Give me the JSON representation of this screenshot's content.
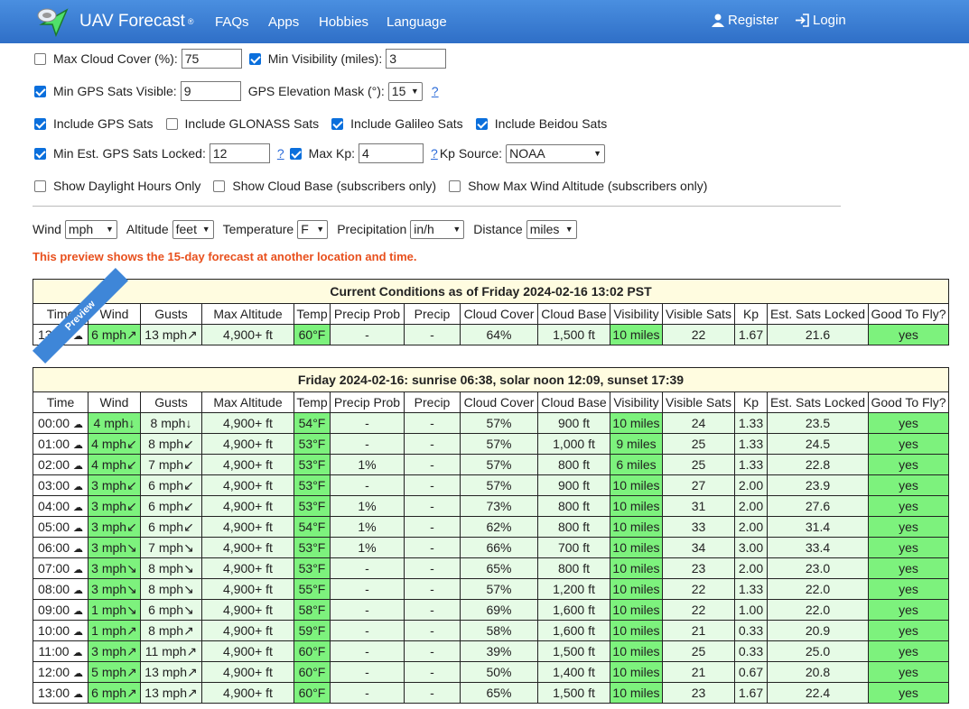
{
  "nav": {
    "brand": "UAV Forecast",
    "brand_mark": "®",
    "links": [
      "FAQs",
      "Apps",
      "Hobbies",
      "Language"
    ],
    "register": "Register",
    "login": "Login"
  },
  "filters": {
    "max_cloud": {
      "label": "Max Cloud Cover (%):",
      "value": "75",
      "checked": false
    },
    "min_vis": {
      "label": "Min Visibility (miles):",
      "value": "3",
      "checked": true
    },
    "min_gps": {
      "label": "Min GPS Sats Visible:",
      "value": "9",
      "checked": true
    },
    "gps_mask": {
      "label": "GPS Elevation Mask (°):",
      "value": "15",
      "help": "?"
    },
    "include_gps": {
      "label": "Include GPS Sats",
      "checked": true
    },
    "include_glonass": {
      "label": "Include GLONASS Sats",
      "checked": false
    },
    "include_galileo": {
      "label": "Include Galileo Sats",
      "checked": true
    },
    "include_beidou": {
      "label": "Include Beidou Sats",
      "checked": true
    },
    "min_locked": {
      "label": "Min Est. GPS Sats Locked:",
      "value": "12",
      "checked": true,
      "help": "?"
    },
    "max_kp": {
      "label": "Max Kp:",
      "value": "4",
      "checked": true,
      "help": "?"
    },
    "kp_source": {
      "label": "Kp Source:",
      "value": "NOAA"
    },
    "daylight": {
      "label": "Show Daylight Hours Only",
      "checked": false
    },
    "cloud_base": {
      "label": "Show Cloud Base (subscribers only)",
      "checked": false
    },
    "max_wind_alt": {
      "label": "Show Max Wind Altitude (subscribers only)",
      "checked": false
    }
  },
  "units": {
    "wind": {
      "label": "Wind",
      "value": "mph"
    },
    "altitude": {
      "label": "Altitude",
      "value": "feet"
    },
    "temperature": {
      "label": "Temperature",
      "value": "F"
    },
    "precipitation": {
      "label": "Precipitation",
      "value": "in/h"
    },
    "distance": {
      "label": "Distance",
      "value": "miles"
    }
  },
  "notice": "This preview shows the 15-day forecast at another location and time.",
  "ribbon": "Preview",
  "columns": [
    "Time",
    "Wind",
    "Gusts",
    "Max Altitude",
    "Temp",
    "Precip Prob",
    "Precip",
    "Cloud Cover",
    "Cloud Base",
    "Visibility",
    "Visible Sats",
    "Kp",
    "Est. Sats Locked",
    "Good To Fly?"
  ],
  "current": {
    "title": "Current Conditions as of Friday 2024-02-16 13:02 PST",
    "row": [
      "13:02",
      "6 mph↗",
      "13 mph↗",
      "4,900+ ft",
      "60°F",
      "-",
      "-",
      "64%",
      "1,500 ft",
      "10 miles",
      "22",
      "1.67",
      "21.6",
      "yes"
    ]
  },
  "daily": {
    "title": "Friday 2024-02-16: sunrise 06:38, solar noon 12:09, sunset 17:39",
    "rows": [
      [
        "00:00",
        "4 mph↓",
        "8 mph↓",
        "4,900+ ft",
        "54°F",
        "-",
        "-",
        "57%",
        "900 ft",
        "10 miles",
        "24",
        "1.33",
        "23.5",
        "yes"
      ],
      [
        "01:00",
        "4 mph↙",
        "8 mph↙",
        "4,900+ ft",
        "53°F",
        "-",
        "-",
        "57%",
        "1,000 ft",
        "9 miles",
        "25",
        "1.33",
        "24.5",
        "yes"
      ],
      [
        "02:00",
        "4 mph↙",
        "7 mph↙",
        "4,900+ ft",
        "53°F",
        "1%",
        "-",
        "57%",
        "800 ft",
        "6 miles",
        "25",
        "1.33",
        "22.8",
        "yes"
      ],
      [
        "03:00",
        "3 mph↙",
        "6 mph↙",
        "4,900+ ft",
        "53°F",
        "-",
        "-",
        "57%",
        "900 ft",
        "10 miles",
        "27",
        "2.00",
        "23.9",
        "yes"
      ],
      [
        "04:00",
        "3 mph↙",
        "6 mph↙",
        "4,900+ ft",
        "53°F",
        "1%",
        "-",
        "73%",
        "800 ft",
        "10 miles",
        "31",
        "2.00",
        "27.6",
        "yes"
      ],
      [
        "05:00",
        "3 mph↙",
        "6 mph↙",
        "4,900+ ft",
        "54°F",
        "1%",
        "-",
        "62%",
        "800 ft",
        "10 miles",
        "33",
        "2.00",
        "31.4",
        "yes"
      ],
      [
        "06:00",
        "3 mph↘",
        "7 mph↘",
        "4,900+ ft",
        "53°F",
        "1%",
        "-",
        "66%",
        "700 ft",
        "10 miles",
        "34",
        "3.00",
        "33.4",
        "yes"
      ],
      [
        "07:00",
        "3 mph↘",
        "8 mph↘",
        "4,900+ ft",
        "53°F",
        "-",
        "-",
        "65%",
        "800 ft",
        "10 miles",
        "23",
        "2.00",
        "23.0",
        "yes"
      ],
      [
        "08:00",
        "3 mph↘",
        "8 mph↘",
        "4,900+ ft",
        "55°F",
        "-",
        "-",
        "57%",
        "1,200 ft",
        "10 miles",
        "22",
        "1.33",
        "22.0",
        "yes"
      ],
      [
        "09:00",
        "1 mph↘",
        "6 mph↘",
        "4,900+ ft",
        "58°F",
        "-",
        "-",
        "69%",
        "1,600 ft",
        "10 miles",
        "22",
        "1.00",
        "22.0",
        "yes"
      ],
      [
        "10:00",
        "1 mph↗",
        "8 mph↗",
        "4,900+ ft",
        "59°F",
        "-",
        "-",
        "58%",
        "1,600 ft",
        "10 miles",
        "21",
        "0.33",
        "20.9",
        "yes"
      ],
      [
        "11:00",
        "3 mph↗",
        "11 mph↗",
        "4,900+ ft",
        "60°F",
        "-",
        "-",
        "39%",
        "1,500 ft",
        "10 miles",
        "25",
        "0.33",
        "25.0",
        "yes"
      ],
      [
        "12:00",
        "5 mph↗",
        "13 mph↗",
        "4,900+ ft",
        "60°F",
        "-",
        "-",
        "50%",
        "1,400 ft",
        "10 miles",
        "21",
        "0.67",
        "20.8",
        "yes"
      ],
      [
        "13:00",
        "6 mph↗",
        "13 mph↗",
        "4,900+ ft",
        "60°F",
        "-",
        "-",
        "65%",
        "1,500 ft",
        "10 miles",
        "23",
        "1.67",
        "22.4",
        "yes"
      ]
    ]
  },
  "colors": {
    "good": "#7df27d",
    "nav": "#3a7fd6",
    "notice": "#e8501d",
    "title_bg": "#fffce0"
  }
}
